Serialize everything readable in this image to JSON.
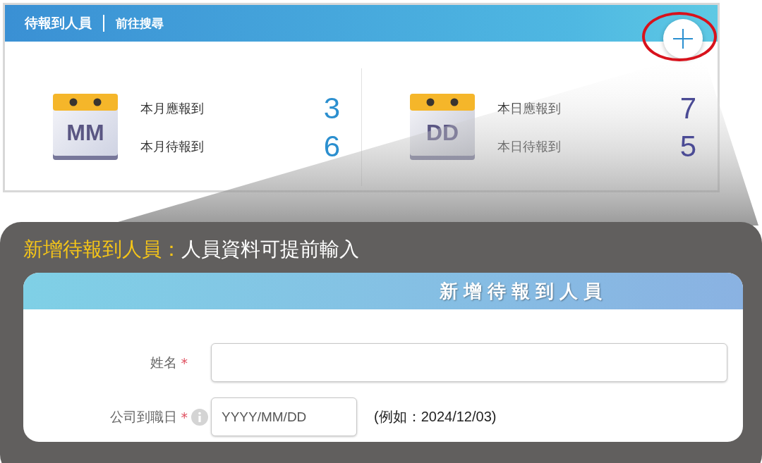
{
  "panel": {
    "title": "待報到人員",
    "link": "前往搜尋",
    "stat_groups": [
      {
        "kind": "month",
        "icon_text": "MM",
        "color": "#2b8fcf",
        "rows": [
          {
            "label": "本月應報到",
            "value": "3"
          },
          {
            "label": "本月待報到",
            "value": "6"
          }
        ]
      },
      {
        "kind": "day",
        "icon_text": "DD",
        "color": "#4b4b95",
        "rows": [
          {
            "label": "本日應報到",
            "value": "7"
          },
          {
            "label": "本日待報到",
            "value": "5"
          }
        ]
      }
    ]
  },
  "callout": {
    "title_highlight": "新增待報到人員：",
    "title_rest": "人員資料可提前輸入"
  },
  "form": {
    "title": "新增待報到人員",
    "fields": [
      {
        "kind": "text",
        "label": "姓名",
        "required_mark": "*",
        "info": false
      },
      {
        "kind": "date",
        "label": "公司到職日",
        "required_mark": "*",
        "info": true,
        "placeholder": "YYYY/MM/DD",
        "hint": "(例如：2024/12/03)"
      }
    ]
  }
}
